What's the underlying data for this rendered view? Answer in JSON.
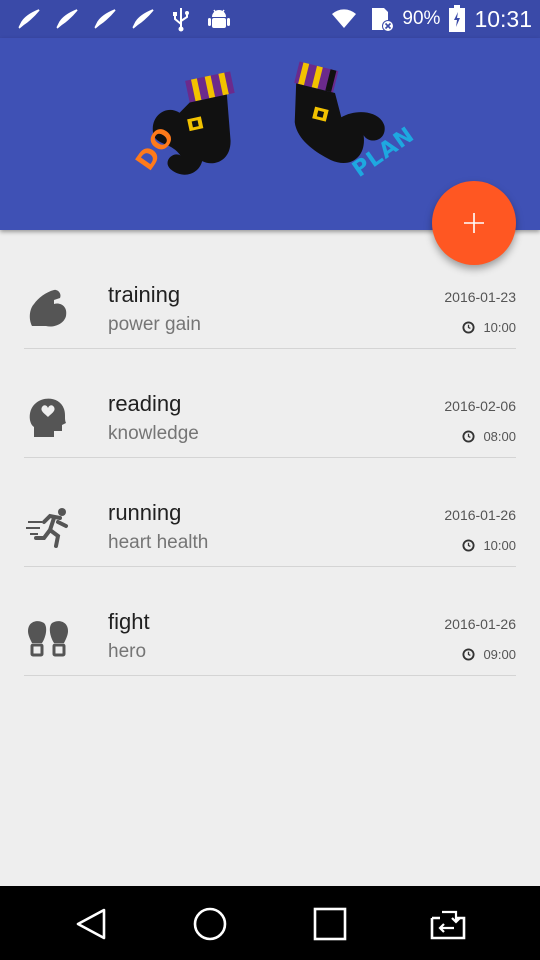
{
  "status_bar": {
    "battery": "90%",
    "time": "10:31",
    "left_icons": [
      "feather-icon",
      "feather-icon",
      "feather-icon",
      "feather-icon",
      "usb-icon",
      "android-debug-icon"
    ],
    "right_icons": [
      "wifi-icon",
      "sim-error-icon",
      "battery-charging-icon"
    ]
  },
  "header": {
    "logo": {
      "word_left": "DO",
      "word_right": "PLAN"
    },
    "colors": {
      "primary": "#3f51b5",
      "accent": "#ff5722"
    }
  },
  "fab": {
    "icon": "plus-icon"
  },
  "plans": [
    {
      "icon": "muscle-icon",
      "title": "training",
      "subtitle": "power gain",
      "date": "2016-01-23",
      "time": "10:00"
    },
    {
      "icon": "head-heart-icon",
      "title": "reading",
      "subtitle": "knowledge",
      "date": "2016-02-06",
      "time": "08:00"
    },
    {
      "icon": "running-man-icon",
      "title": "running",
      "subtitle": "heart health",
      "date": "2016-01-26",
      "time": "10:00"
    },
    {
      "icon": "boxing-gloves-icon",
      "title": "fight",
      "subtitle": "hero",
      "date": "2016-01-26",
      "time": "09:00"
    }
  ],
  "nav": {
    "buttons": [
      "back-icon",
      "home-icon",
      "recents-icon",
      "screen-switch-icon"
    ]
  }
}
